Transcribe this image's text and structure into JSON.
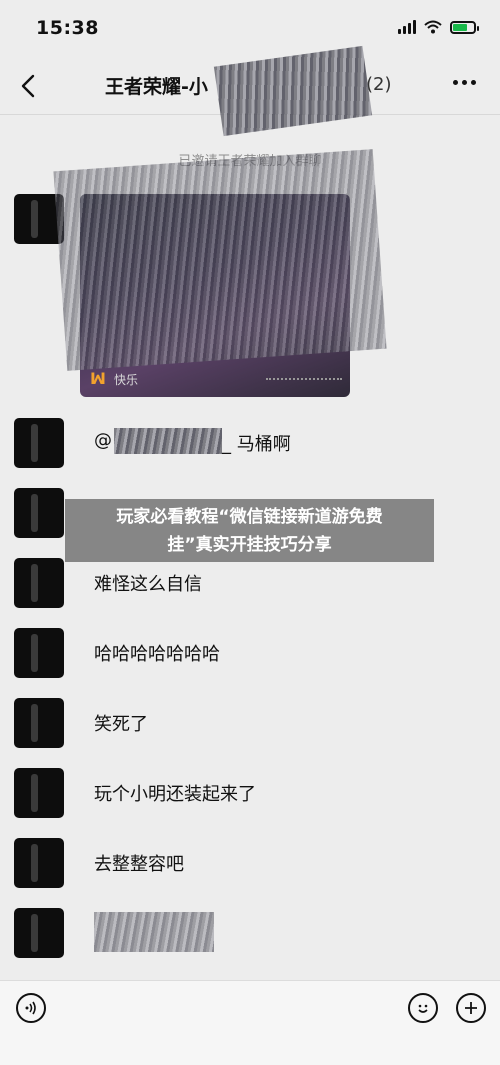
{
  "status": {
    "time": "15:38"
  },
  "nav": {
    "title": "王者荣耀-小",
    "count": "(2)"
  },
  "system_message": "已邀请王者荣耀加入群聊",
  "video_card": {
    "source": "快乐"
  },
  "messages": [
    {
      "text": "@"
    },
    {
      "text": "_ 马桶啊"
    },
    {
      "text": "难怪这么自信"
    },
    {
      "text": "哈哈哈哈哈哈哈"
    },
    {
      "text": "笑死了"
    },
    {
      "text": "玩个小明还装起来了"
    },
    {
      "text": "去整整容吧"
    }
  ],
  "banner": {
    "line1": "玩家必看教程“微信链接新道游免费",
    "line2": "挂”真实开挂技巧分享"
  },
  "colors": {
    "background": "#ededed",
    "banner": "#787878",
    "battery": "#19b94a",
    "video_accent": "#f2a22d"
  }
}
